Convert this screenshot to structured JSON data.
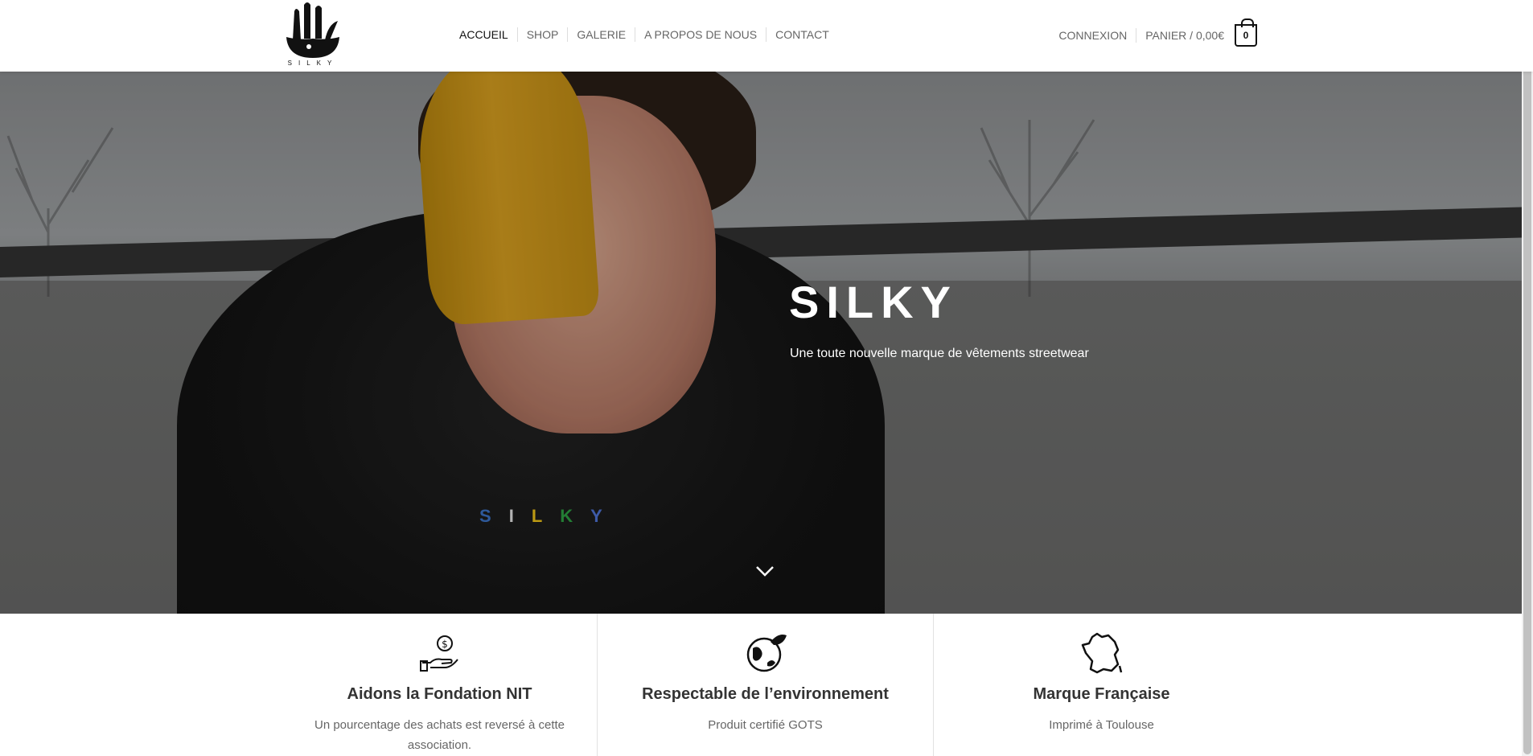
{
  "header": {
    "logo_text": "SILKY",
    "nav": [
      {
        "label": "ACCUEIL",
        "active": true
      },
      {
        "label": "SHOP",
        "active": false
      },
      {
        "label": "GALERIE",
        "active": false
      },
      {
        "label": "A PROPOS DE NOUS",
        "active": false
      },
      {
        "label": "CONTACT",
        "active": false
      }
    ],
    "account_label": "CONNEXION",
    "cart_label": "PANIER / 0,00€",
    "cart_count": "0"
  },
  "hero": {
    "title": "SILKY",
    "subtitle": "Une toute nouvelle marque de vêtements streetwear",
    "hood_letters": [
      "S",
      "I",
      "L",
      "K",
      "Y"
    ]
  },
  "features": [
    {
      "icon": "hand-coin-icon",
      "title": "Aidons la Fondation NIT",
      "text": "Un pourcentage des achats est reversé à cette association."
    },
    {
      "icon": "eco-globe-icon",
      "title": "Respectable de l’environnement",
      "text": "Produit certifié GOTS"
    },
    {
      "icon": "france-map-icon",
      "title": "Marque Française",
      "text": "Imprimé à Toulouse"
    }
  ],
  "colors": {
    "accent": "#111111",
    "beanie": "#d9a020",
    "hood_logo": [
      "#3b73c6",
      "#e6e6e6",
      "#f0c419",
      "#2ea043",
      "#4f74d6"
    ]
  }
}
